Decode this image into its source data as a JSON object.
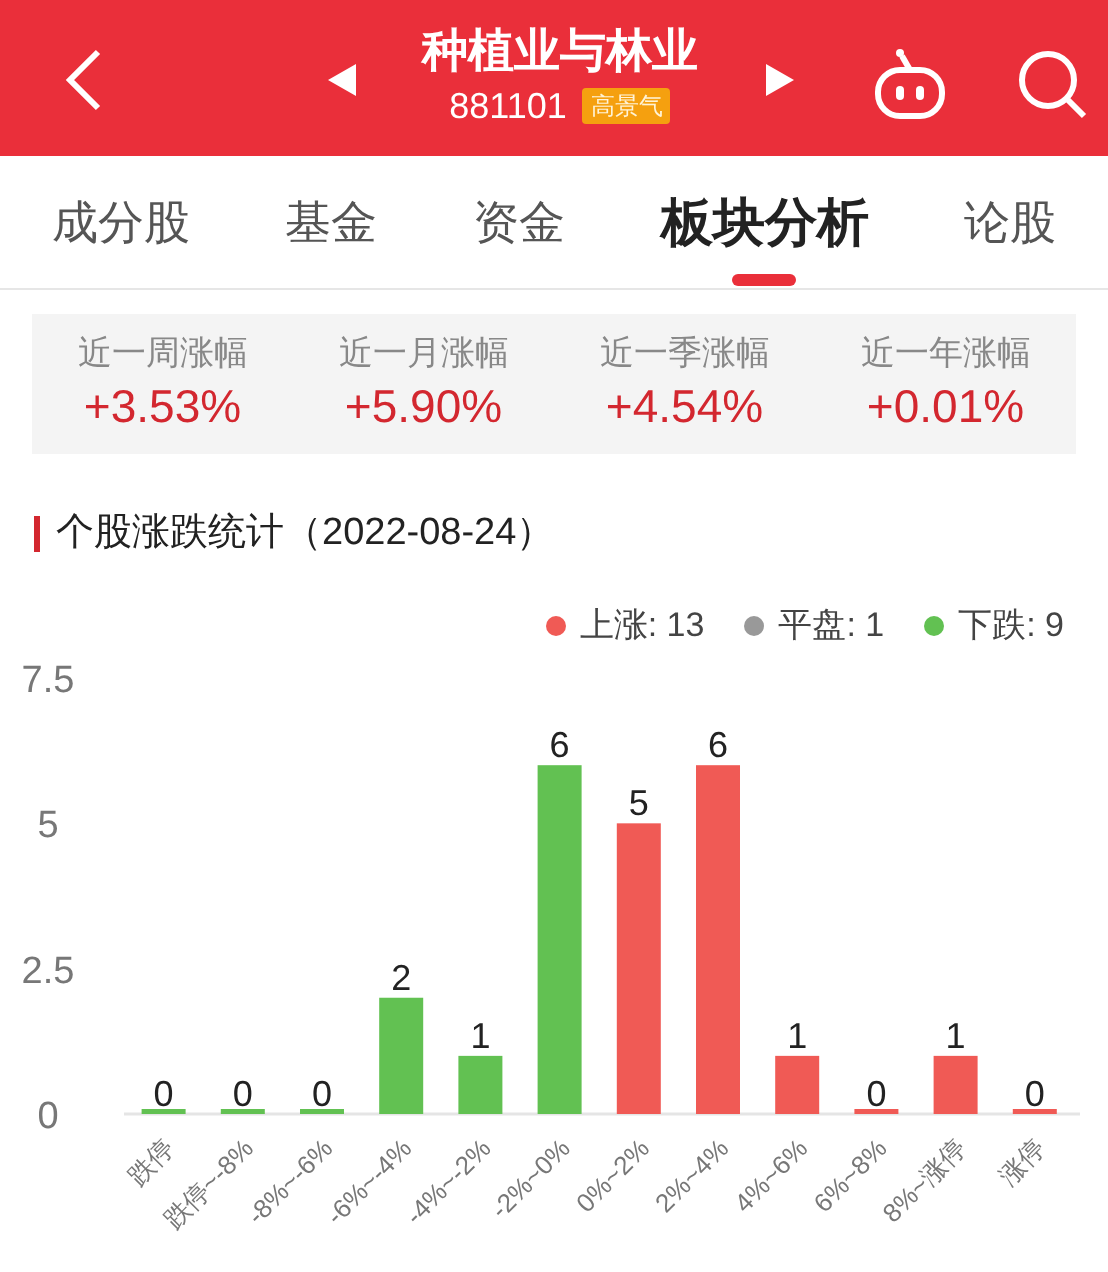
{
  "header": {
    "title": "种植业与林业",
    "code": "881101",
    "badge": "高景气"
  },
  "tabs": [
    {
      "label": "成分股",
      "selected": false
    },
    {
      "label": "基金",
      "selected": false
    },
    {
      "label": "资金",
      "selected": false
    },
    {
      "label": "板块分析",
      "selected": true
    },
    {
      "label": "论股",
      "selected": false
    }
  ],
  "stats": [
    {
      "label": "近一周涨幅",
      "value": "+3.53%"
    },
    {
      "label": "近一月涨幅",
      "value": "+5.90%"
    },
    {
      "label": "近一季涨幅",
      "value": "+4.54%"
    },
    {
      "label": "近一年涨幅",
      "value": "+0.01%"
    }
  ],
  "section_title": "个股涨跌统计（2022-08-24）",
  "legend": [
    {
      "kind": "series",
      "suffix": ": 13"
    },
    {
      "kind": "plain",
      "label": "平盘: 1",
      "color": "#999999"
    },
    {
      "kind": "series",
      "suffix": ": 9"
    }
  ],
  "chart_data": {
    "type": "bar",
    "stacked": true,
    "data_labels": true,
    "categories": [
      "跌停",
      "跌停~-8%",
      "-8%~-6%",
      "-6%~-4%",
      "-4%~-2%",
      "-2%~0%",
      "0%~2%",
      "2%~4%",
      "4%~6%",
      "6%~8%",
      "8%~涨停",
      "涨停"
    ],
    "ylim": [
      0,
      7.5
    ],
    "yticks": [
      0,
      2.5,
      5,
      7.5
    ],
    "series": [
      {
        "name": "上涨",
        "color": "#f05a55",
        "values": [
          null,
          null,
          null,
          null,
          null,
          null,
          5,
          6,
          1,
          0,
          1,
          0
        ]
      },
      {
        "name": "下跌",
        "color": "#62c152",
        "values": [
          0,
          0,
          0,
          2,
          1,
          6,
          null,
          null,
          null,
          null,
          null,
          null
        ]
      }
    ]
  }
}
